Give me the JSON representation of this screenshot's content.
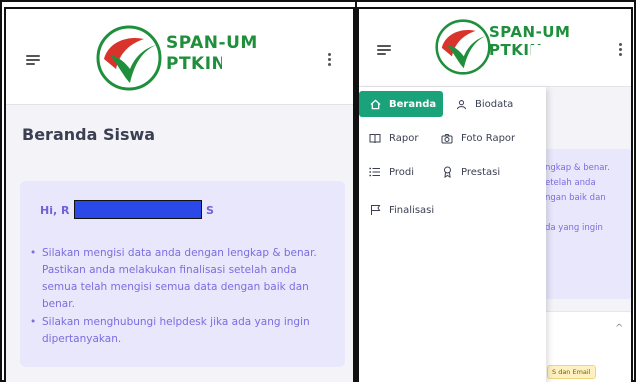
{
  "left": {
    "logo_line1": "SPAN-UM",
    "logo_line2": "PTKIN",
    "page_title": "Beranda Siswa",
    "greeting_prefix": "Hi, R",
    "greeting_suffix": "S",
    "notes": [
      "Silakan mengisi data anda dengan lengkap & benar. Pastikan anda melakukan finalisasi setelah anda semua telah mengisi semua data dengan baik dan benar.",
      "Silakan menghubungi helpdesk jika ada yang ingin dipertanyakan."
    ]
  },
  "right": {
    "logo_line1": "SPAN-UM",
    "logo_line2": "PTKIN",
    "menu": {
      "beranda": "Beranda",
      "biodata": "Biodata",
      "rapor": "Rapor",
      "foto_rapor": "Foto Rapor",
      "prodi": "Prodi",
      "prestasi": "Prestasi",
      "finalisasi": "Finalisasi"
    },
    "bg_lines": [
      "ngkap & benar.",
      "etelah anda",
      "ngan baik dan",
      "",
      "da yang ingin"
    ],
    "badge": "S dan Email"
  },
  "colors": {
    "accent_green": "#1aa37a",
    "alert_bg": "#e8e7fb",
    "alert_text": "#7a6ee0",
    "redaction_blue": "#2a49e6"
  }
}
